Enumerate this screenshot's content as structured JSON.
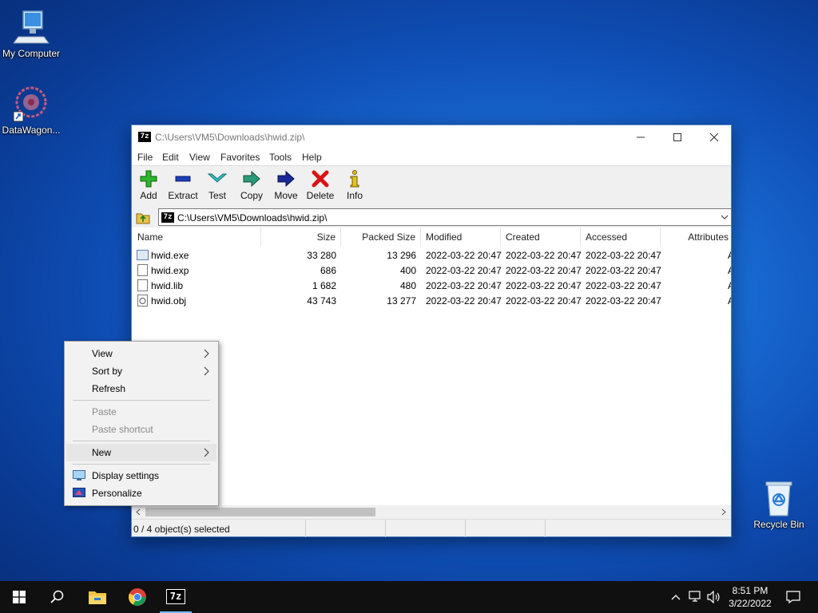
{
  "desktop": {
    "icons": [
      {
        "label": "My Computer"
      },
      {
        "label": "DataWagon..."
      },
      {
        "label": "Recycle Bin"
      }
    ]
  },
  "window": {
    "title": "C:\\Users\\VM5\\Downloads\\hwid.zip\\",
    "app_icon_text": "7z",
    "menu": [
      "File",
      "Edit",
      "View",
      "Favorites",
      "Tools",
      "Help"
    ],
    "toolbar": [
      {
        "label": "Add",
        "icon": "add-icon"
      },
      {
        "label": "Extract",
        "icon": "extract-icon"
      },
      {
        "label": "Test",
        "icon": "test-icon"
      },
      {
        "label": "Copy",
        "icon": "copy-icon"
      },
      {
        "label": "Move",
        "icon": "move-icon"
      },
      {
        "label": "Delete",
        "icon": "delete-icon"
      },
      {
        "label": "Info",
        "icon": "info-icon"
      }
    ],
    "address": "C:\\Users\\VM5\\Downloads\\hwid.zip\\",
    "columns": [
      "Name",
      "Size",
      "Packed Size",
      "Modified",
      "Created",
      "Accessed",
      "Attributes"
    ],
    "files": [
      {
        "name": "hwid.exe",
        "size": "33 280",
        "packed": "13 296",
        "modified": "2022-03-22 20:47",
        "created": "2022-03-22 20:47",
        "accessed": "2022-03-22 20:47",
        "attr": "A"
      },
      {
        "name": "hwid.exp",
        "size": "686",
        "packed": "400",
        "modified": "2022-03-22 20:47",
        "created": "2022-03-22 20:47",
        "accessed": "2022-03-22 20:47",
        "attr": "A"
      },
      {
        "name": "hwid.lib",
        "size": "1 682",
        "packed": "480",
        "modified": "2022-03-22 20:47",
        "created": "2022-03-22 20:47",
        "accessed": "2022-03-22 20:47",
        "attr": "A"
      },
      {
        "name": "hwid.obj",
        "size": "43 743",
        "packed": "13 277",
        "modified": "2022-03-22 20:47",
        "created": "2022-03-22 20:47",
        "accessed": "2022-03-22 20:47",
        "attr": "A"
      }
    ],
    "status": "0 / 4 object(s) selected"
  },
  "context_menu": {
    "items": [
      {
        "label": "View",
        "submenu": true
      },
      {
        "label": "Sort by",
        "submenu": true
      },
      {
        "label": "Refresh"
      },
      {
        "label": "Paste",
        "disabled": true
      },
      {
        "label": "Paste shortcut",
        "disabled": true
      },
      {
        "label": "New",
        "submenu": true
      },
      {
        "label": "Display settings",
        "icon": "display-settings-icon"
      },
      {
        "label": "Personalize",
        "icon": "personalize-icon"
      }
    ]
  },
  "taskbar": {
    "time": "8:51 PM",
    "date": "3/22/2022",
    "pinned_app_label": "7z"
  },
  "colors": {
    "accent": "#76b9ed",
    "taskbar": "#101010",
    "desktop": "#1a6fd8"
  }
}
